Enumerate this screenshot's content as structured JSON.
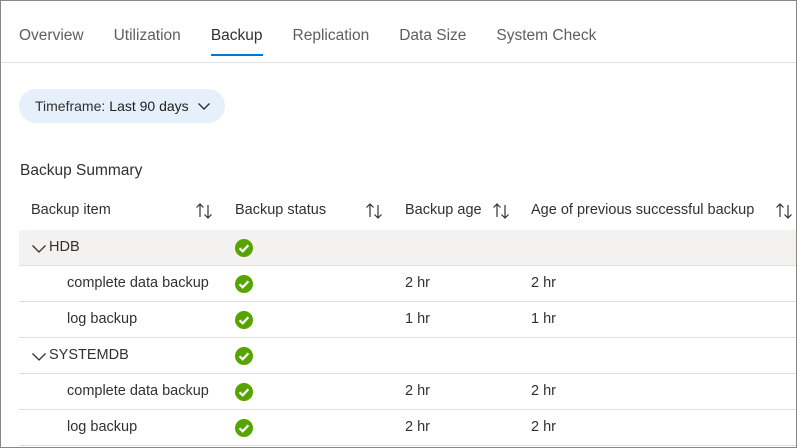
{
  "tabs": [
    {
      "label": "Overview"
    },
    {
      "label": "Utilization"
    },
    {
      "label": "Backup",
      "active": true
    },
    {
      "label": "Replication"
    },
    {
      "label": "Data Size"
    },
    {
      "label": "System Check"
    }
  ],
  "timeframe": {
    "prefix": "Timeframe:",
    "value": "Last 90 days"
  },
  "section_title": "Backup Summary",
  "columns": [
    "Backup item",
    "Backup status",
    "Backup age",
    "Age of previous successful backup"
  ],
  "rows": [
    {
      "item": "HDB",
      "status": "success",
      "age": "",
      "prev": ""
    },
    {
      "item": "complete data backup",
      "status": "success",
      "age": "2 hr",
      "prev": "2 hr"
    },
    {
      "item": "log backup",
      "status": "success",
      "age": "1 hr",
      "prev": "1 hr"
    },
    {
      "item": "SYSTEMDB",
      "status": "success",
      "age": "",
      "prev": ""
    },
    {
      "item": "complete data backup",
      "status": "success",
      "age": "2 hr",
      "prev": "2 hr"
    },
    {
      "item": "log backup",
      "status": "success",
      "age": "2 hr",
      "prev": "2 hr"
    }
  ],
  "colors": {
    "accent": "#0078d4",
    "success": "#57a300",
    "group_bg": "#f3f2f1",
    "pill_bg": "#e5f0fb"
  }
}
